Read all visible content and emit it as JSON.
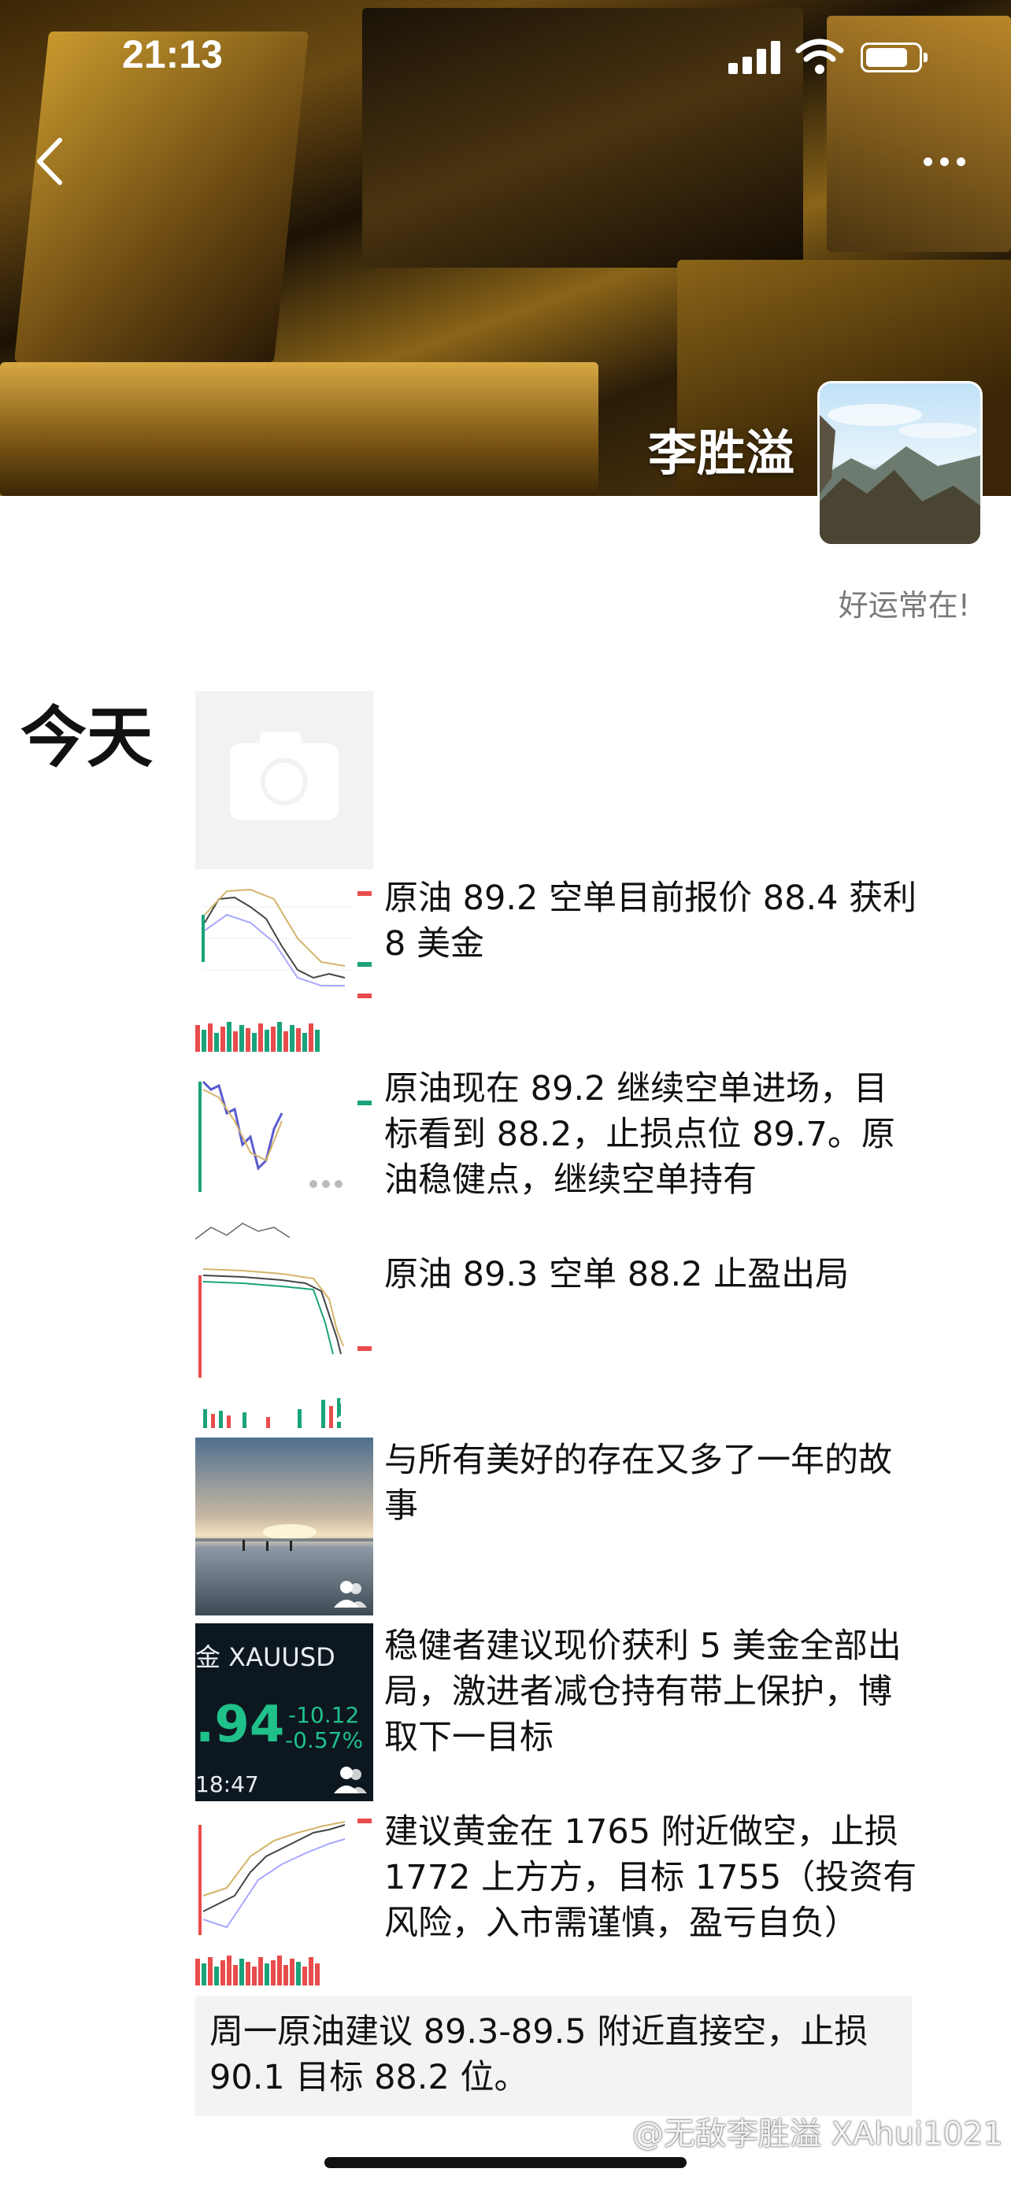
{
  "status_bar": {
    "time": "21:13"
  },
  "cover": {
    "image": "gold-bars"
  },
  "profile": {
    "name": "李胜溢",
    "signature": "好运常在!"
  },
  "feed": {
    "date_label": "今天",
    "posts": [
      {
        "thumb": "oil-chart",
        "text": "原油 89.2 空单目前报价 88.4 获利 8 美金"
      },
      {
        "thumb": "oil-chart",
        "text": "原油现在 89.2 继续空单进场，目标看到 88.2，止损点位 89.7。原油稳健点，继续空单持有"
      },
      {
        "thumb": "oil-chart",
        "text": "原油 89.3 空单 88.2 止盈出局"
      },
      {
        "thumb": "beach-sunset-photo",
        "text": "与所有美好的存在又多了一年的故事"
      },
      {
        "thumb": "gold-quote",
        "text": "稳健者建议现价获利 5 美金全部出局，激进者减仓持有带上保护，博取下一目标"
      },
      {
        "thumb": "gold-chart",
        "text": "建议黄金在 1765 附近做空，止损 1772 上方方，目标 1755（投资有风险，入市需谨慎，盈亏自负）"
      }
    ],
    "text_post": "周一原油建议 89.3-89.5 附近直接空，止损 90.1 目标 88.2 位。",
    "quote_tile": {
      "label": "金 XAUUSD",
      "price": ".94",
      "change": "-10.12",
      "change_pct": "-0.57%",
      "time": "18:47"
    }
  },
  "watermark": "@无敌李胜溢 XAhui1021",
  "colors": {
    "up": "#e84c4c",
    "down": "#1aa37a",
    "quote_bg": "#0d1720"
  }
}
